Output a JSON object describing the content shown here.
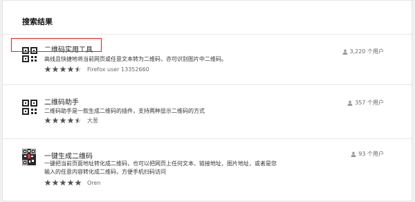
{
  "header": {
    "title": "搜索结果"
  },
  "results": [
    {
      "name": "二维码实用工具",
      "description": "高线且快捷地将当前网页或任意文本转为二维码，亦可识别图片中二维码。",
      "rating": 4.5,
      "author": "Firefox user 13352660",
      "users": "3,220 个用户",
      "icon": "qr-code-icon"
    },
    {
      "name": "二维码助手",
      "description": "二维码助手是一款生成二维码的插件，支持两种显示二维码的方式",
      "rating": 4.5,
      "author": "大葱",
      "users": "357 个用户",
      "icon": "qr-code-icon"
    },
    {
      "name": "一键生成二维码",
      "description": "一键把当前页面地址转化成二维码，也可以把网页上任何文本、链接地址、图片地址，或者是您输入的任意内容转化成二维码，方便手机扫码访问",
      "rating": 5,
      "author": "Oren",
      "users": "93 个用户",
      "icon": "qr-code-color-icon"
    }
  ],
  "colors": {
    "star": "#555555",
    "highlight": "#e02020",
    "background": "#f1f1f3"
  }
}
